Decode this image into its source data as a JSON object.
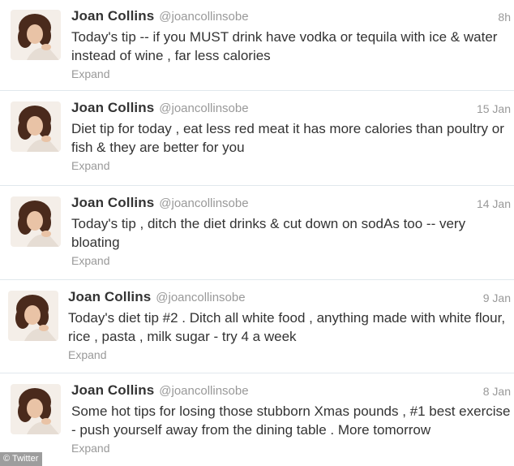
{
  "tweets": [
    {
      "name": "Joan Collins",
      "handle": "@joancollinsobe",
      "time": "8h",
      "text": "Today's tip -- if you MUST drink have vodka or tequila with ice & water instead of wine , far less calories",
      "expand": "Expand"
    },
    {
      "name": "Joan Collins",
      "handle": "@joancollinsobe",
      "time": "15 Jan",
      "text": "Diet tip for today , eat less red meat it has more calories than poultry or fish & they are better for you",
      "expand": "Expand"
    },
    {
      "name": "Joan Collins",
      "handle": "@joancollinsobe",
      "time": "14 Jan",
      "text": "Today's tip , ditch the diet drinks & cut down on sodAs too -- very bloating",
      "expand": "Expand"
    },
    {
      "name": "Joan Collins",
      "handle": "@joancollinsobe",
      "time": "9 Jan",
      "text": "Today's diet tip #2 . Ditch all white food , anything made with white flour, rice , pasta , milk sugar - try 4 a week",
      "expand": "Expand"
    },
    {
      "name": "Joan Collins",
      "handle": "@joancollinsobe",
      "time": "8 Jan",
      "text": "Some hot tips for losing those stubborn Xmas pounds , #1 best exercise - push yourself away from the dining table . More tomorrow",
      "expand": "Expand"
    }
  ],
  "watermark": "© Twitter",
  "colors": {
    "name": "#333333",
    "meta": "#999999",
    "divider": "#e1e8ed",
    "avatar_hair": "#4a2a1c",
    "avatar_skin": "#e9c3a6",
    "avatar_bg": "#f4eee8"
  }
}
